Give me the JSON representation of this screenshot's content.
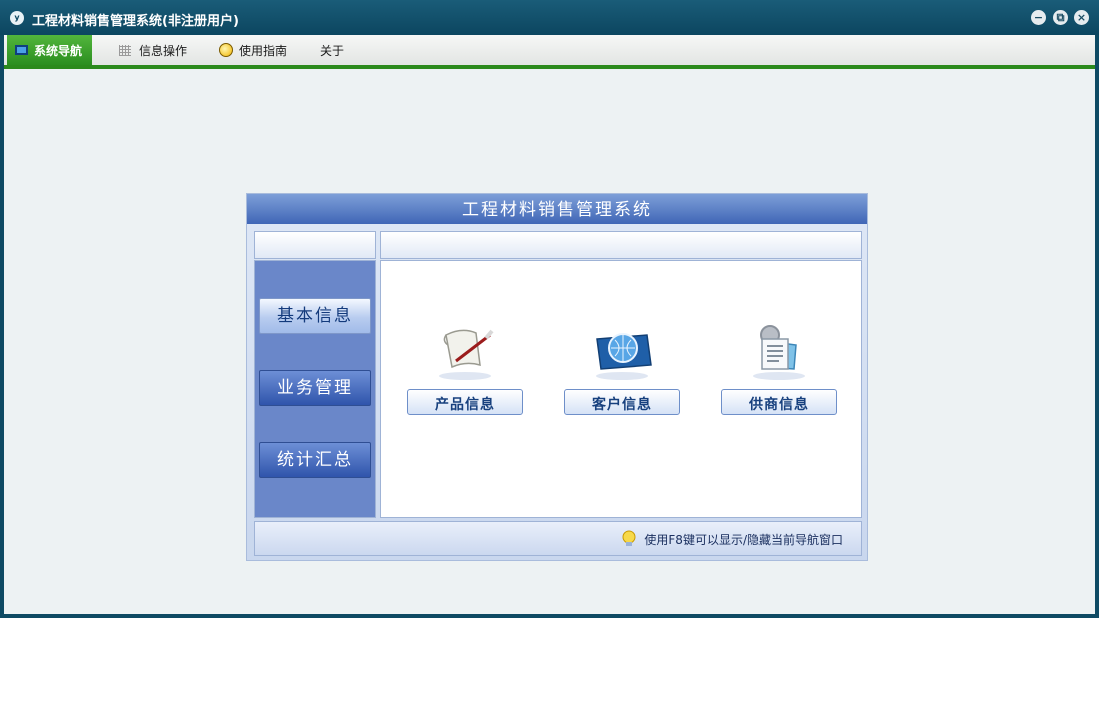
{
  "window": {
    "title": "工程材料销售管理系统(非注册用户)",
    "app_icon": "y"
  },
  "window_controls": {
    "minimize": "−",
    "restore": "⧉",
    "close": "×"
  },
  "menu": [
    {
      "label": "系统导航",
      "icon": "monitor-icon",
      "active": true
    },
    {
      "label": "信息操作",
      "icon": "grid-icon",
      "active": false
    },
    {
      "label": "使用指南",
      "icon": "bulb-icon",
      "active": false
    },
    {
      "label": "关于",
      "icon": "",
      "active": false
    }
  ],
  "panel": {
    "title": "工程材料销售管理系统",
    "nav": [
      "基本信息",
      "业务管理",
      "统计汇总"
    ],
    "selected_nav": "基本信息",
    "features": [
      {
        "label": "产品信息",
        "icon": "scroll-quill-icon"
      },
      {
        "label": "客户信息",
        "icon": "globe-folder-icon"
      },
      {
        "label": "供商信息",
        "icon": "gear-document-icon"
      }
    ],
    "tip": "使用F8键可以显示/隐藏当前导航窗口"
  },
  "colors": {
    "title_bar": "#0e4a63",
    "menu_active": "#3a9f2a",
    "panel_header": "#4a6fbc",
    "nav_panel": "#6a87c9"
  }
}
